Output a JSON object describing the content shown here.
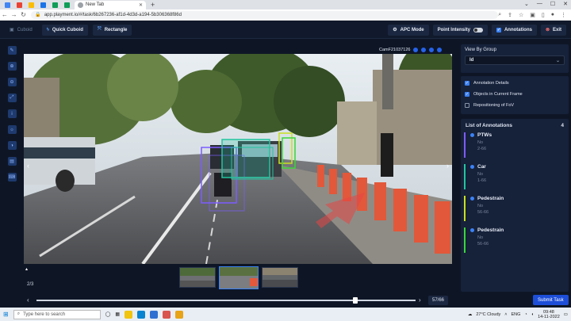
{
  "browser": {
    "tab_title": "New Tab",
    "url": "app.playment.io/#/task/6b267236-af1d-4d3d-a194-5b306368f86d"
  },
  "toolbar": {
    "cuboid_label": "Cuboid",
    "quick_cuboid_label": "Quick Cuboid",
    "rectangle_label": "Rectangle",
    "apc_mode_label": "APC Mode",
    "point_intensity_label": "Point Intensity",
    "annotations_label": "Annotations",
    "exit_label": "Exit"
  },
  "viewport": {
    "camera_name": "CamF21037126",
    "frame_position": "2/3"
  },
  "timeline": {
    "frame_counter": "57/66",
    "progress": 0.84,
    "submit_label": "Submit Task"
  },
  "view_by_group": {
    "title": "View By Group",
    "selected": "Id"
  },
  "options": [
    {
      "label": "Annotation Details",
      "checked": true
    },
    {
      "label": "Objects in Current Frame",
      "checked": true
    },
    {
      "label": "Repositioning of FoV",
      "checked": false
    }
  ],
  "annotations": {
    "title": "List of Annotations",
    "count": "4",
    "items": [
      {
        "name": "PTWs",
        "sub1": "No",
        "sub2": "2-66",
        "color": "#7c5cff"
      },
      {
        "name": "Car",
        "sub1": "No",
        "sub2": "1-66",
        "color": "#22c5a0"
      },
      {
        "name": "Pedestrain",
        "sub1": "No",
        "sub2": "56-66",
        "color": "#c8e020"
      },
      {
        "name": "Pedestrain",
        "sub1": "No",
        "sub2": "56-66",
        "color": "#3ad63a"
      }
    ]
  },
  "taskbar": {
    "search_placeholder": "Type here to search",
    "weather": "27°C  Cloudy",
    "language": "ENG",
    "time": "09:48",
    "date": "14-11-2022"
  }
}
